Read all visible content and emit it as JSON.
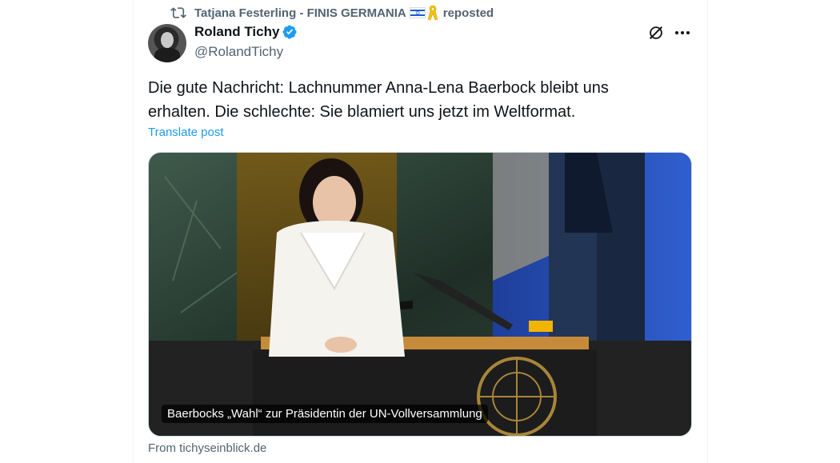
{
  "repost": {
    "user": "Tatjana Festerling - FINIS GERMANIA",
    "label": "reposted",
    "icons": [
      "repost-icon",
      "israel-flag-icon",
      "yellow-ribbon-icon"
    ]
  },
  "author": {
    "name": "Roland Tichy",
    "handle": "@RolandTichy",
    "verified": true,
    "avatar": "avatar"
  },
  "actions": {
    "icons": [
      "grok-icon",
      "more-icon"
    ]
  },
  "tweet": {
    "text_line1": "Die gute Nachricht: Lachnummer Anna-Lena Baerbock bleibt uns",
    "text_line2": "erhalten. Die schlechte: Sie blamiert uns jetzt im Weltformat.",
    "translate_label": "Translate post"
  },
  "card": {
    "caption": "Baerbocks „Wahl“ zur Präsidentin der UN-Vollversammlung",
    "source": "From tichyseinblick.de"
  },
  "colors": {
    "accent": "#1d9bf0",
    "text": "#0f1419",
    "secondary": "#536471"
  }
}
